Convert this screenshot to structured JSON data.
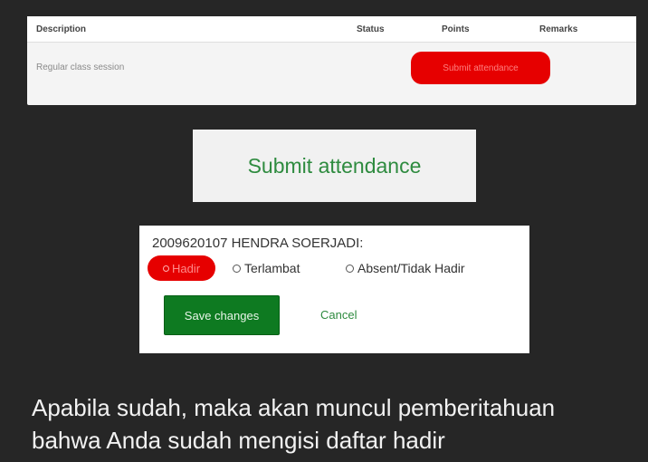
{
  "table": {
    "headers": {
      "description": "Description",
      "status": "Status",
      "points": "Points",
      "remarks": "Remarks"
    },
    "row": {
      "description": "Regular class session",
      "action": "Submit attendance"
    }
  },
  "submit_box": {
    "label": "Submit attendance"
  },
  "form": {
    "student": "2009620107 HENDRA SOERJADI:",
    "options": {
      "hadir": "Hadir",
      "terlambat": "Terlambat",
      "absent": "Absent/Tidak Hadir"
    },
    "selected": "Hadir",
    "save_label": "Save changes",
    "cancel_label": "Cancel"
  },
  "caption": {
    "line1": "Apabila sudah, maka akan muncul pemberitahuan",
    "line2": "bahwa Anda sudah mengisi daftar hadir"
  },
  "colors": {
    "highlight": "#e60000",
    "primary_green": "#0e7a21",
    "link_green": "#2e8b3f",
    "background": "#262626"
  }
}
